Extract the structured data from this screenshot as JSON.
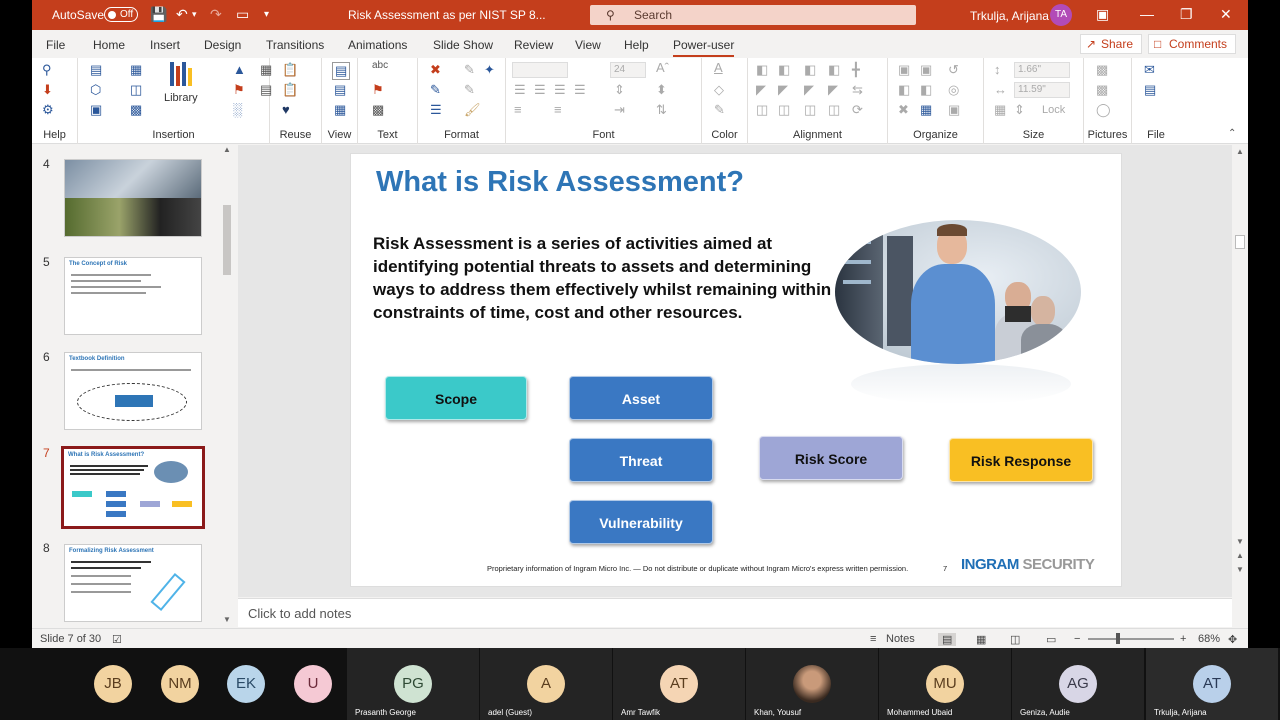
{
  "titlebar": {
    "autosave_label": "AutoSave",
    "autosave_state": "Off",
    "document_title": "Risk Assessment as per NIST SP 8...",
    "search_placeholder": "Search",
    "user_name": "Trkulja, Arijana",
    "user_initials": "TA"
  },
  "menu": {
    "items": [
      "File",
      "Home",
      "Insert",
      "Design",
      "Transitions",
      "Animations",
      "Slide Show",
      "Review",
      "View",
      "Help",
      "Power-user"
    ],
    "active": "Power-user",
    "share_label": "Share",
    "comments_label": "Comments"
  },
  "ribbon": {
    "groups": [
      "Help",
      "Insertion",
      "Reuse",
      "View",
      "Text",
      "Format",
      "Font",
      "Color",
      "Alignment",
      "Organize",
      "Size",
      "Pictures",
      "File"
    ],
    "library_label": "Library",
    "font_size": "24",
    "width_value": "1.66\"",
    "height_value": "11.59\"",
    "lock_label": "Lock"
  },
  "thumbnails": [
    {
      "num": "4",
      "title": ""
    },
    {
      "num": "5",
      "title": "The Concept of Risk"
    },
    {
      "num": "6",
      "title": "Textbook Definition"
    },
    {
      "num": "7",
      "title": "What is Risk Assessment?"
    },
    {
      "num": "8",
      "title": "Formalizing Risk Assessment"
    }
  ],
  "slide": {
    "title": "What is Risk Assessment?",
    "body": "Risk Assessment is a series of activities aimed at identifying potential threats to assets and determining ways to address them effectively whilst remaining within constraints of time, cost and other resources.",
    "boxes": {
      "scope": "Scope",
      "asset": "Asset",
      "threat": "Threat",
      "vulnerability": "Vulnerability",
      "risk_score": "Risk Score",
      "risk_response": "Risk Response"
    },
    "footer": "Proprietary information of Ingram Micro Inc. — Do not distribute or duplicate without Ingram Micro's express written permission.",
    "page_number": "7",
    "logo_main": "INGRAM",
    "logo_sub": "SECURITY"
  },
  "notes_placeholder": "Click to add notes",
  "statusbar": {
    "slide_info": "Slide 7 of 30",
    "notes_label": "Notes",
    "zoom": "68%"
  },
  "participants": [
    {
      "initials": "JB",
      "name": ""
    },
    {
      "initials": "NM",
      "name": ""
    },
    {
      "initials": "EK",
      "name": ""
    },
    {
      "initials": "U",
      "name": ""
    },
    {
      "initials": "PG",
      "name": "Prasanth George"
    },
    {
      "initials": "A",
      "name": "adel (Guest)"
    },
    {
      "initials": "AT",
      "name": "Amr Tawfik"
    },
    {
      "initials": "",
      "name": "Khan, Yousuf"
    },
    {
      "initials": "MU",
      "name": "Mohammed Ubaid"
    },
    {
      "initials": "AG",
      "name": "Geniza, Audie"
    },
    {
      "initials": "AT",
      "name": "Trkulja, Arijana"
    }
  ],
  "colors": {
    "accent": "#c43e1c",
    "title_blue": "#2e75b6",
    "scope": "#3bc9c9",
    "asset": "#3a78c3",
    "risk_score": "#9ea6d6",
    "risk_response": "#f9bf23"
  }
}
